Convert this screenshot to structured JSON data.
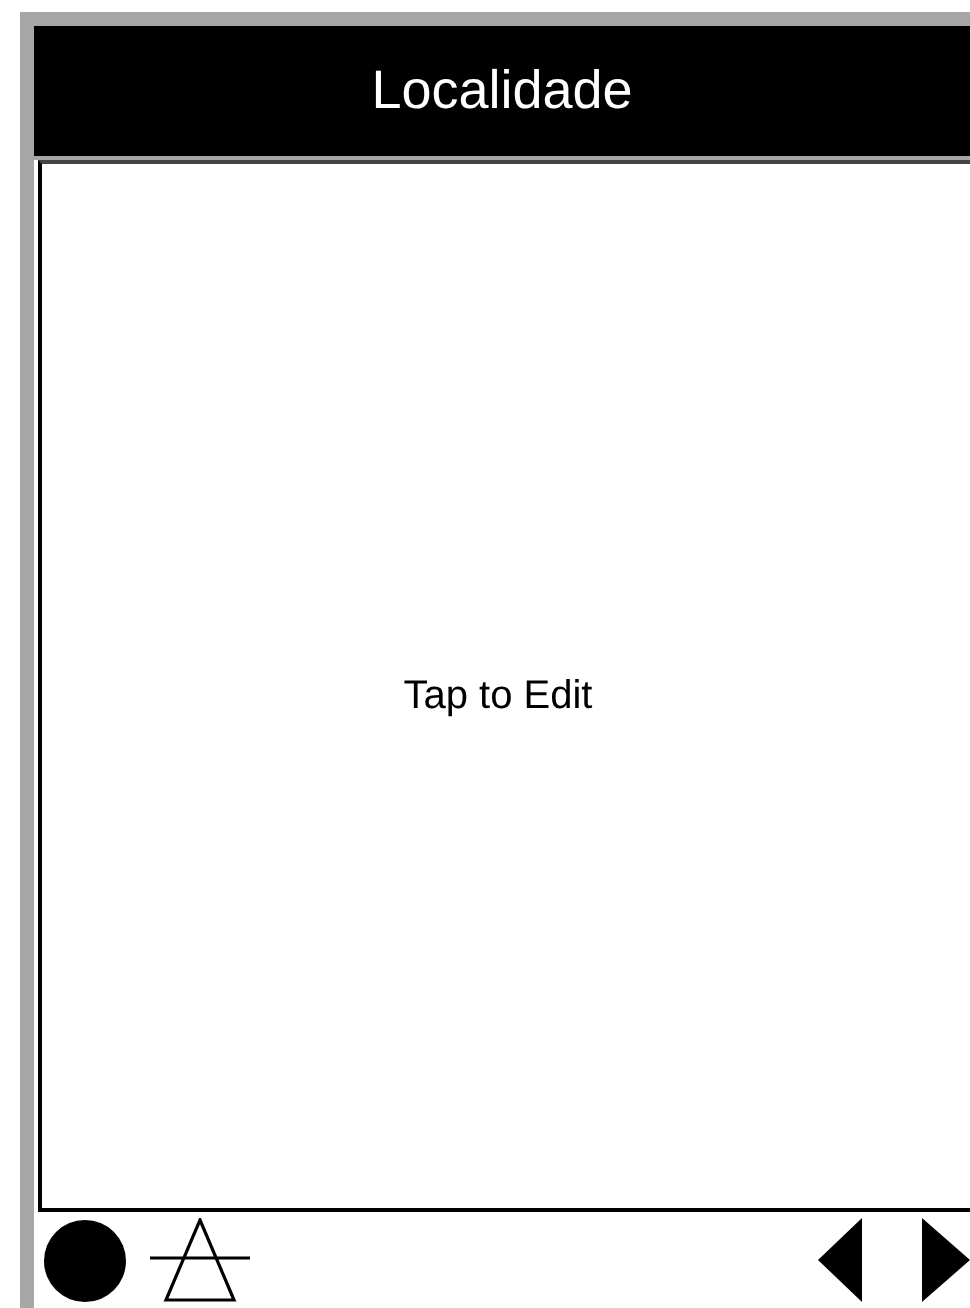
{
  "header": {
    "title": "Localidade"
  },
  "content": {
    "hint": "Tap to Edit"
  }
}
